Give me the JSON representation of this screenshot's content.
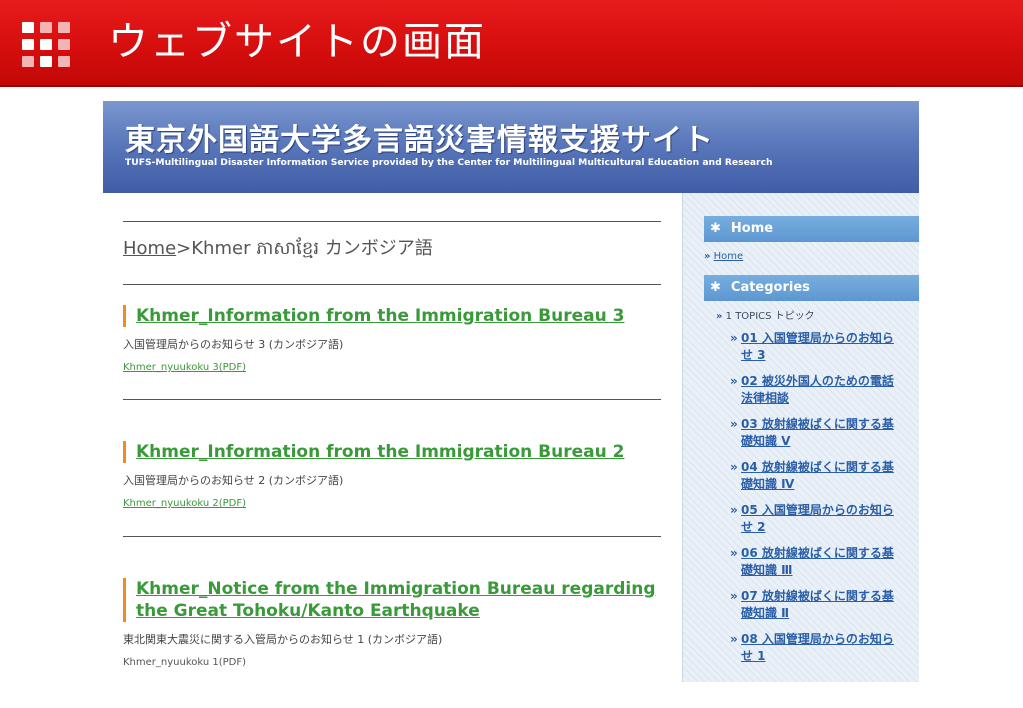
{
  "slide": {
    "title": "ウェブサイトの画面",
    "logo_colors": [
      "#ffffff",
      "#f4b4b4"
    ]
  },
  "site": {
    "title": "東京外国語大学多言語災害情報支援サイト",
    "subtitle": "TUFS-Multilingual Disaster Information Service provided by the Center for Multilingual Multicultural Education and Research"
  },
  "breadcrumb": {
    "home": "Home",
    "separator": ">",
    "current": "Khmer ភាសាខ្មែរ カンボジア語"
  },
  "posts": [
    {
      "title": "Khmer_Information from the Immigration Bureau 3",
      "description": "入国管理局からのお知らせ 3 (カンボジア語)",
      "link": "Khmer_nyuukoku 3(PDF)"
    },
    {
      "title": "Khmer_Information from the Immigration Bureau 2",
      "description": "入国管理局からのお知らせ 2 (カンボジア語)",
      "link": "Khmer_nyuukoku 2(PDF)"
    },
    {
      "title": "Khmer_Notice from the Immigration Bureau regarding the Great Tohoku/Kanto Earthquake",
      "description": "東北関東大震災に関する入管局からのお知らせ 1 (カンボジア語)",
      "link": "Khmer_nyuukoku 1(PDF)"
    }
  ],
  "sidebar": {
    "home_heading": "Home",
    "home_link": "Home",
    "categories_heading": "Categories",
    "topic": "1 TOPICS トピック",
    "star_glyph": "✱",
    "chevron_glyph": "»",
    "categories": [
      "01 入国管理局からのお知らせ 3",
      "02 被災外国人のための電話法律相談",
      "03 放射線被ばくに関する基礎知識 Ⅴ",
      "04 放射線被ばくに関する基礎知識 Ⅳ",
      "05 入国管理局からのお知らせ 2",
      "06 放射線被ばくに関する基礎知識 Ⅲ",
      "07 放射線被ばくに関する基礎知識 Ⅱ",
      "08 入国管理局からのお知らせ 1"
    ]
  },
  "colors": {
    "slide_red": "#d40d0d",
    "banner_blue": "#4f6db3",
    "link_green": "#3a9a3a",
    "accent_orange": "#f08c1e",
    "sidebar_link_blue": "#2a5fa8",
    "sidebar_head_blue": "#6aa2d8"
  }
}
